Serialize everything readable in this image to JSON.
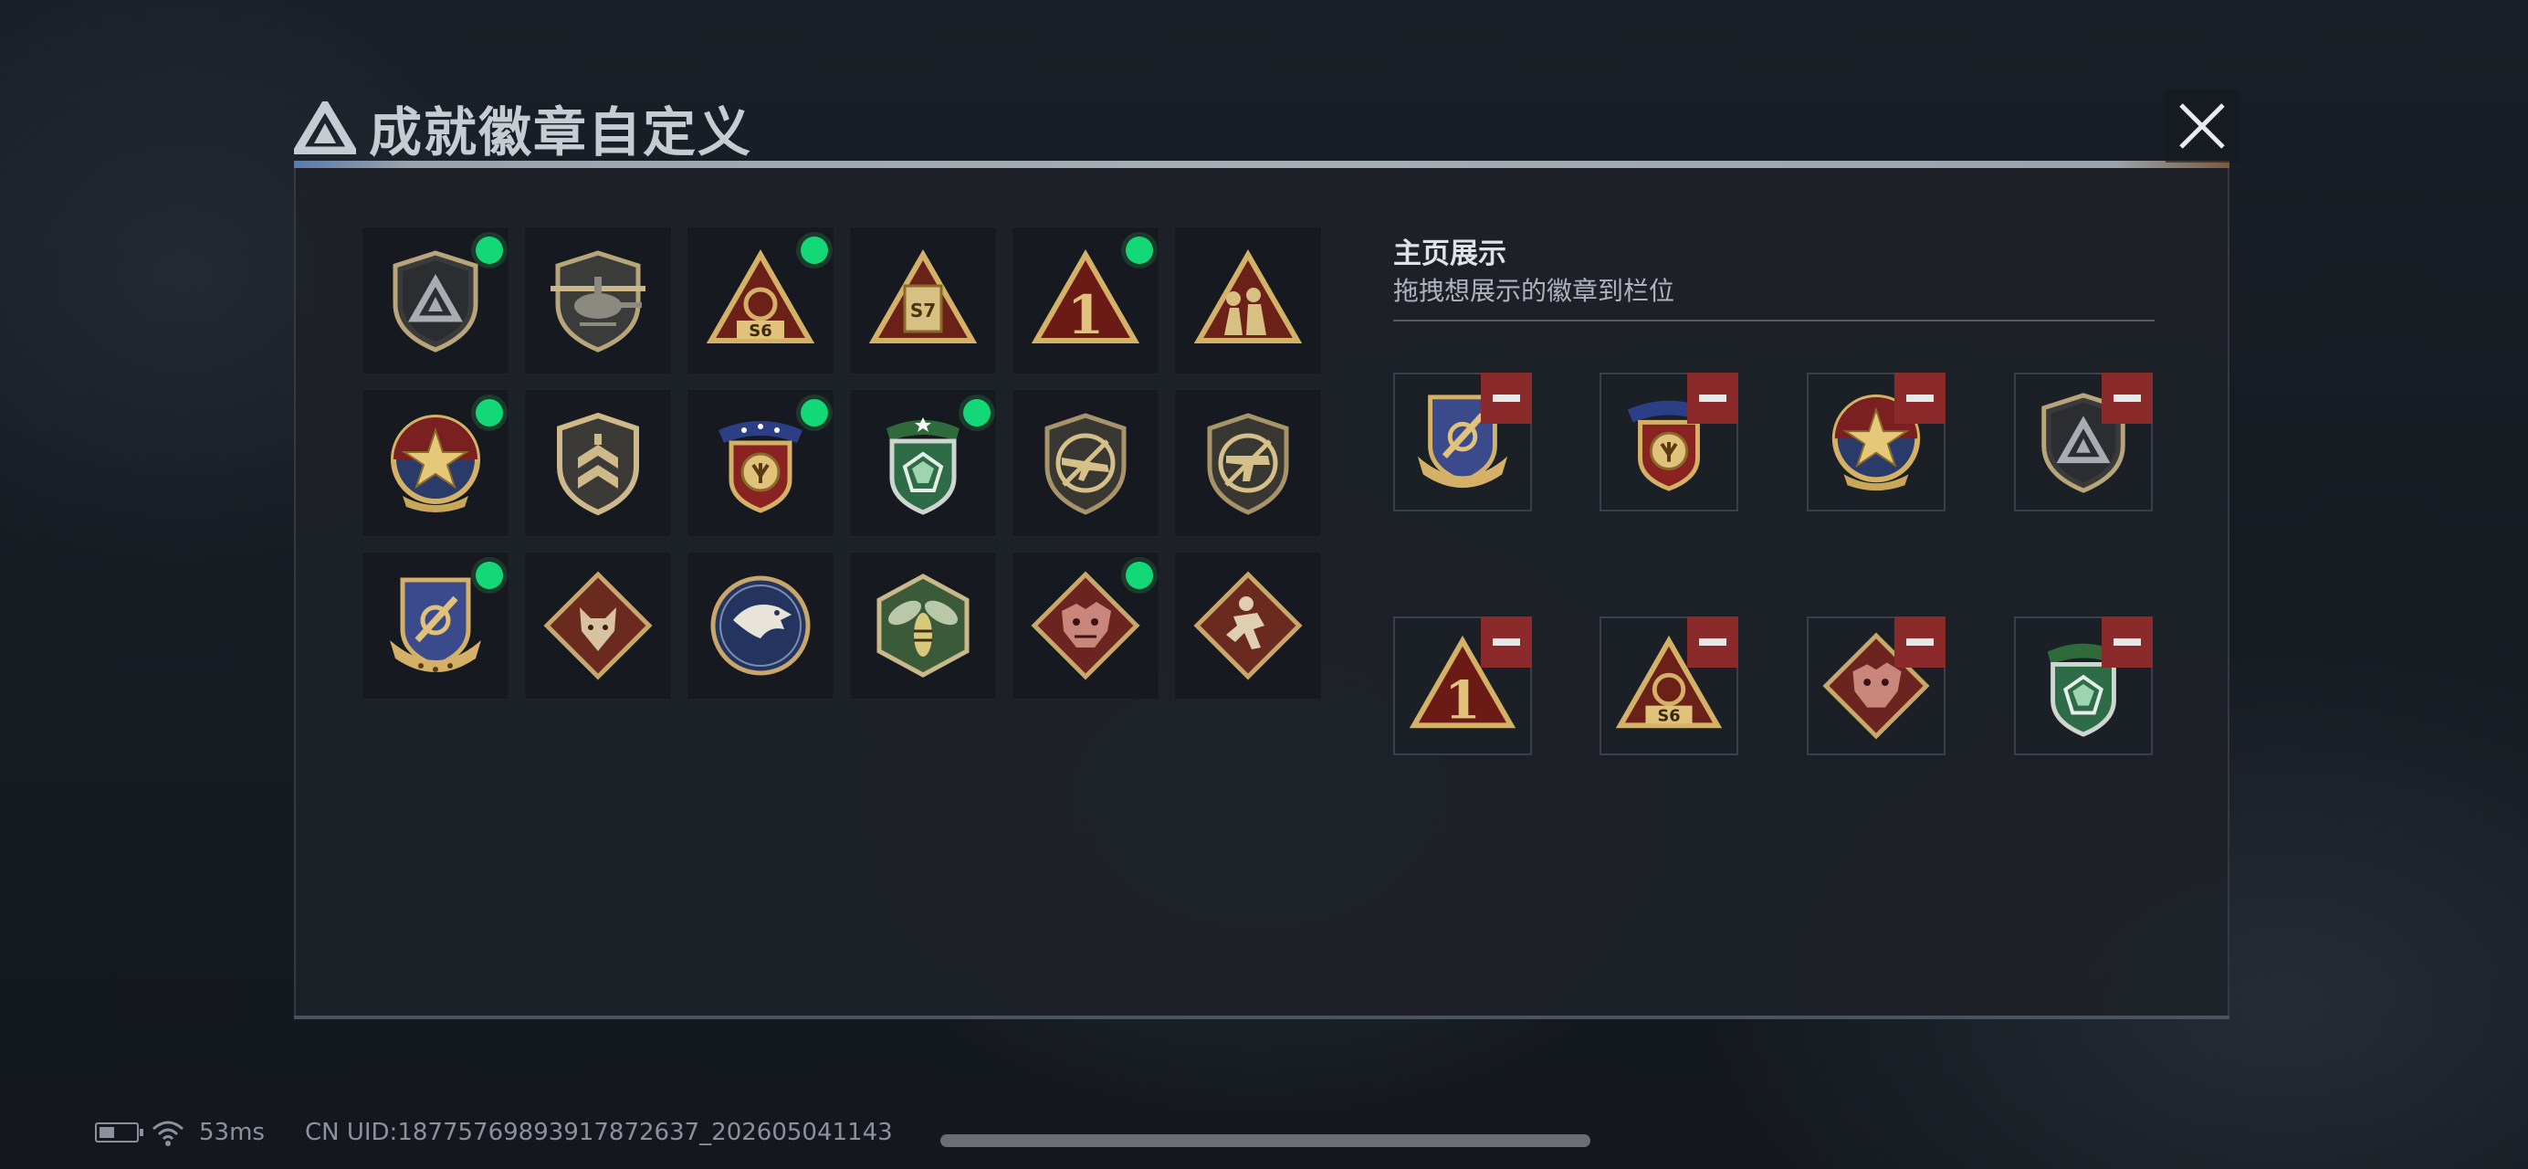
{
  "header": {
    "title": "成就徽章自定义",
    "logo_icon": "triangle-logo-icon",
    "close_icon": "close-icon"
  },
  "badges": [
    {
      "name": "shield-triangle",
      "equipped": true
    },
    {
      "name": "helicopter",
      "equipped": false
    },
    {
      "name": "s6-triangle",
      "equipped": true
    },
    {
      "name": "s7-triangle",
      "equipped": false
    },
    {
      "name": "number-1-triangle",
      "equipped": true
    },
    {
      "name": "soldiers-triangle",
      "equipped": false
    },
    {
      "name": "star-medal",
      "equipped": true
    },
    {
      "name": "chevron-shield",
      "equipped": false
    },
    {
      "name": "crown-medal",
      "equipped": true
    },
    {
      "name": "green-gem-shield",
      "equipped": true
    },
    {
      "name": "rifle-crossed",
      "equipped": false
    },
    {
      "name": "smg-crossed",
      "equipped": false
    },
    {
      "name": "anchor-shield",
      "equipped": true
    },
    {
      "name": "wolf-diamond",
      "equipped": false
    },
    {
      "name": "eagle-circle",
      "equipped": false
    },
    {
      "name": "wasp-hexagon",
      "equipped": false
    },
    {
      "name": "dragon-diamond",
      "equipped": true
    },
    {
      "name": "runner-diamond",
      "equipped": false
    }
  ],
  "showcase": {
    "title": "主页展示",
    "hint": "拖拽想展示的徽章到栏位",
    "slots": [
      {
        "badge": "anchor-shield"
      },
      {
        "badge": "crown-medal"
      },
      {
        "badge": "star-medal"
      },
      {
        "badge": "shield-triangle"
      },
      {
        "badge": "number-1-triangle"
      },
      {
        "badge": "s6-triangle"
      },
      {
        "badge": "dragon-diamond"
      },
      {
        "badge": "green-gem-shield"
      }
    ],
    "remove_icon": "minus-icon"
  },
  "status_bar": {
    "ping": "53ms",
    "uid": "CN UID:1877576989391787263​7_202605041143",
    "battery_icon": "battery-icon",
    "wifi_icon": "wifi-icon"
  },
  "colors": {
    "equipped_dot": "#13d877",
    "remove_button": "#8a2a2a",
    "panel_bg": "#1d2128"
  }
}
